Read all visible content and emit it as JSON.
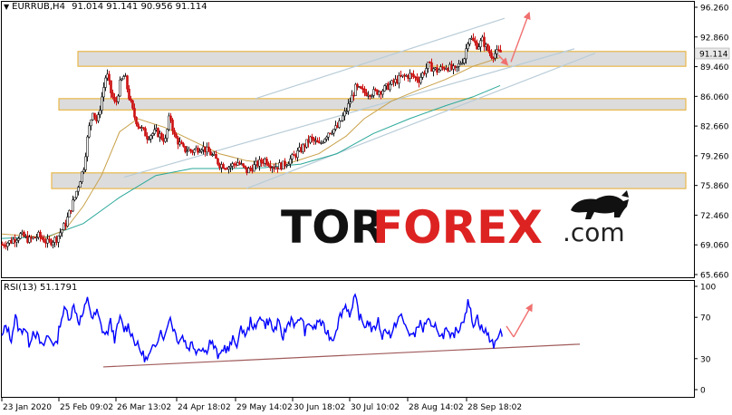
{
  "header": {
    "symbol": "EURRUB,H4",
    "ohlc": "91.014 91.141 90.956 91.114"
  },
  "rsi_header": "RSI(13) 51.1791",
  "watermark": {
    "part1": "TOR",
    "part2": "FOREX",
    "part3": ".com"
  },
  "colors": {
    "up_candle": "#1a1a1a",
    "down_candle": "#cc1111",
    "ma_fast": "#c8a048",
    "ma_slow": "#2aa89a",
    "channel": "#b8ccd8",
    "zone_fill": "#d6d6d6",
    "zone_border": "#e8b84a",
    "arrow": "#f07070",
    "rsi_line": "#0000ff",
    "rsi_trend": "#a05a5a",
    "price_tag": "#e8e8e8"
  },
  "chart_data": [
    {
      "type": "candlestick",
      "symbol": "EURRUB",
      "timeframe": "H4",
      "ylim": [
        65.66,
        96.26
      ],
      "y_ticks": [
        96.26,
        92.86,
        89.46,
        86.06,
        82.66,
        79.26,
        75.86,
        72.46,
        69.06,
        65.66
      ],
      "current_price_label": "91.114",
      "x_tick_labels": [
        "23 Jan 2020",
        "25 Feb 09:02",
        "26 Mar 13:02",
        "24 Apr 18:02",
        "29 May 14:02",
        "30 Jun 18:02",
        "30 Jul 10:02",
        "28 Aug 14:02",
        "28 Sep 18:02"
      ],
      "close_path": [
        [
          0,
          69.1
        ],
        [
          10,
          69.5
        ],
        [
          20,
          70.2
        ],
        [
          30,
          69.6
        ],
        [
          40,
          70.1
        ],
        [
          50,
          69.3
        ],
        [
          60,
          69.8
        ],
        [
          70,
          71.5
        ],
        [
          80,
          74.5
        ],
        [
          90,
          78.0
        ],
        [
          95,
          82.0
        ],
        [
          100,
          84.5
        ],
        [
          105,
          83.0
        ],
        [
          110,
          86.0
        ],
        [
          115,
          88.8
        ],
        [
          120,
          86.5
        ],
        [
          125,
          85.0
        ],
        [
          130,
          87.5
        ],
        [
          135,
          88.5
        ],
        [
          140,
          86.0
        ],
        [
          145,
          84.0
        ],
        [
          150,
          82.8
        ],
        [
          160,
          81.5
        ],
        [
          170,
          82.0
        ],
        [
          180,
          81.0
        ],
        [
          185,
          84.0
        ],
        [
          190,
          81.5
        ],
        [
          200,
          80.0
        ],
        [
          210,
          79.8
        ],
        [
          220,
          80.3
        ],
        [
          230,
          79.5
        ],
        [
          240,
          78.3
        ],
        [
          250,
          78.0
        ],
        [
          260,
          78.5
        ],
        [
          270,
          77.5
        ],
        [
          280,
          78.2
        ],
        [
          290,
          78.8
        ],
        [
          300,
          78.0
        ],
        [
          310,
          78.2
        ],
        [
          320,
          79.0
        ],
        [
          330,
          80.0
        ],
        [
          340,
          81.2
        ],
        [
          350,
          80.5
        ],
        [
          360,
          82.0
        ],
        [
          370,
          82.5
        ],
        [
          380,
          84.5
        ],
        [
          390,
          87.0
        ],
        [
          400,
          86.5
        ],
        [
          410,
          86.5
        ],
        [
          420,
          86.8
        ],
        [
          430,
          87.5
        ],
        [
          440,
          88.2
        ],
        [
          450,
          88.5
        ],
        [
          460,
          88.0
        ],
        [
          470,
          89.6
        ],
        [
          480,
          89.0
        ],
        [
          490,
          89.5
        ],
        [
          500,
          89.0
        ],
        [
          505,
          89.8
        ],
        [
          510,
          90.5
        ],
        [
          515,
          93.0
        ],
        [
          520,
          92.3
        ],
        [
          525,
          91.8
        ],
        [
          530,
          92.5
        ],
        [
          535,
          91.5
        ],
        [
          540,
          90.8
        ],
        [
          545,
          91.0
        ],
        [
          550,
          91.114
        ]
      ],
      "ma_fast_path": [
        [
          0,
          70.3
        ],
        [
          50,
          69.9
        ],
        [
          70,
          70.8
        ],
        [
          90,
          73.5
        ],
        [
          110,
          77.0
        ],
        [
          130,
          82.0
        ],
        [
          150,
          83.5
        ],
        [
          180,
          82.5
        ],
        [
          210,
          81.0
        ],
        [
          240,
          79.5
        ],
        [
          270,
          78.7
        ],
        [
          300,
          78.3
        ],
        [
          320,
          78.5
        ],
        [
          350,
          79.5
        ],
        [
          380,
          81.5
        ],
        [
          400,
          83.5
        ],
        [
          430,
          85.5
        ],
        [
          460,
          86.8
        ],
        [
          490,
          88.0
        ],
        [
          520,
          89.5
        ],
        [
          550,
          90.5
        ]
      ],
      "ma_slow_path": [
        [
          0,
          69.8
        ],
        [
          50,
          70.0
        ],
        [
          90,
          71.5
        ],
        [
          130,
          74.5
        ],
        [
          170,
          77.0
        ],
        [
          210,
          77.8
        ],
        [
          250,
          77.8
        ],
        [
          290,
          77.9
        ],
        [
          330,
          78.3
        ],
        [
          370,
          79.5
        ],
        [
          410,
          81.8
        ],
        [
          450,
          83.5
        ],
        [
          490,
          85.0
        ],
        [
          520,
          86.0
        ],
        [
          550,
          87.3
        ]
      ],
      "support_resistance_zones": [
        [
          89.5,
          91.2
        ],
        [
          84.5,
          85.8
        ],
        [
          75.5,
          77.3
        ]
      ],
      "channel_lines": [
        [
          [
            280,
            85.8
          ],
          [
            555,
            95.0
          ]
        ],
        [
          [
            135,
            76.8
          ],
          [
            632,
            91.5
          ]
        ],
        [
          [
            270,
            75.5
          ],
          [
            655,
            91.0
          ]
        ]
      ],
      "forecast_arrows": [
        [
          [
            548,
            90.8
          ],
          [
            558,
            89.7
          ]
        ],
        [
          [
            562,
            90.0
          ],
          [
            582,
            95.6
          ]
        ]
      ]
    },
    {
      "type": "line",
      "name": "RSI(13)",
      "last_value": 51.1791,
      "ylim": [
        0,
        100
      ],
      "y_ticks": [
        100,
        70,
        30,
        0
      ],
      "rsi_path": [
        [
          0,
          50
        ],
        [
          5,
          63
        ],
        [
          10,
          48
        ],
        [
          15,
          70
        ],
        [
          20,
          55
        ],
        [
          25,
          62
        ],
        [
          30,
          45
        ],
        [
          35,
          58
        ],
        [
          40,
          50
        ],
        [
          45,
          40
        ],
        [
          50,
          52
        ],
        [
          55,
          48
        ],
        [
          60,
          42
        ],
        [
          65,
          68
        ],
        [
          70,
          78
        ],
        [
          75,
          70
        ],
        [
          80,
          82
        ],
        [
          85,
          65
        ],
        [
          90,
          74
        ],
        [
          95,
          88
        ],
        [
          100,
          68
        ],
        [
          105,
          75
        ],
        [
          110,
          60
        ],
        [
          115,
          52
        ],
        [
          120,
          65
        ],
        [
          125,
          48
        ],
        [
          130,
          70
        ],
        [
          135,
          58
        ],
        [
          140,
          62
        ],
        [
          145,
          50
        ],
        [
          150,
          42
        ],
        [
          155,
          35
        ],
        [
          160,
          28
        ],
        [
          165,
          36
        ],
        [
          170,
          45
        ],
        [
          175,
          58
        ],
        [
          180,
          50
        ],
        [
          185,
          72
        ],
        [
          190,
          58
        ],
        [
          195,
          48
        ],
        [
          200,
          52
        ],
        [
          205,
          40
        ],
        [
          210,
          45
        ],
        [
          215,
          38
        ],
        [
          220,
          42
        ],
        [
          225,
          36
        ],
        [
          230,
          48
        ],
        [
          235,
          40
        ],
        [
          240,
          30
        ],
        [
          245,
          42
        ],
        [
          250,
          38
        ],
        [
          255,
          48
        ],
        [
          260,
          45
        ],
        [
          265,
          60
        ],
        [
          270,
          52
        ],
        [
          275,
          68
        ],
        [
          280,
          56
        ],
        [
          285,
          74
        ],
        [
          290,
          62
        ],
        [
          295,
          68
        ],
        [
          300,
          56
        ],
        [
          305,
          65
        ],
        [
          310,
          50
        ],
        [
          315,
          62
        ],
        [
          320,
          70
        ],
        [
          325,
          60
        ],
        [
          330,
          72
        ],
        [
          335,
          55
        ],
        [
          340,
          65
        ],
        [
          345,
          58
        ],
        [
          350,
          68
        ],
        [
          355,
          60
        ],
        [
          360,
          55
        ],
        [
          365,
          48
        ],
        [
          370,
          62
        ],
        [
          375,
          75
        ],
        [
          380,
          82
        ],
        [
          385,
          72
        ],
        [
          390,
          90
        ],
        [
          395,
          70
        ],
        [
          400,
          62
        ],
        [
          405,
          66
        ],
        [
          410,
          55
        ],
        [
          415,
          68
        ],
        [
          420,
          52
        ],
        [
          425,
          60
        ],
        [
          430,
          50
        ],
        [
          435,
          65
        ],
        [
          440,
          72
        ],
        [
          445,
          62
        ],
        [
          450,
          55
        ],
        [
          455,
          50
        ],
        [
          460,
          66
        ],
        [
          465,
          58
        ],
        [
          470,
          70
        ],
        [
          475,
          56
        ],
        [
          480,
          62
        ],
        [
          485,
          50
        ],
        [
          490,
          58
        ],
        [
          495,
          48
        ],
        [
          500,
          55
        ],
        [
          505,
          60
        ],
        [
          510,
          70
        ],
        [
          515,
          85
        ],
        [
          520,
          64
        ],
        [
          525,
          70
        ],
        [
          530,
          58
        ],
        [
          535,
          55
        ],
        [
          540,
          48
        ],
        [
          545,
          42
        ],
        [
          548,
          56
        ],
        [
          552,
          51.2
        ]
      ],
      "trend_line": [
        [
          112,
          22
        ],
        [
          638,
          44
        ]
      ],
      "forecast_arrow": [
        [
          565,
          51
        ],
        [
          585,
          82
        ]
      ]
    }
  ]
}
